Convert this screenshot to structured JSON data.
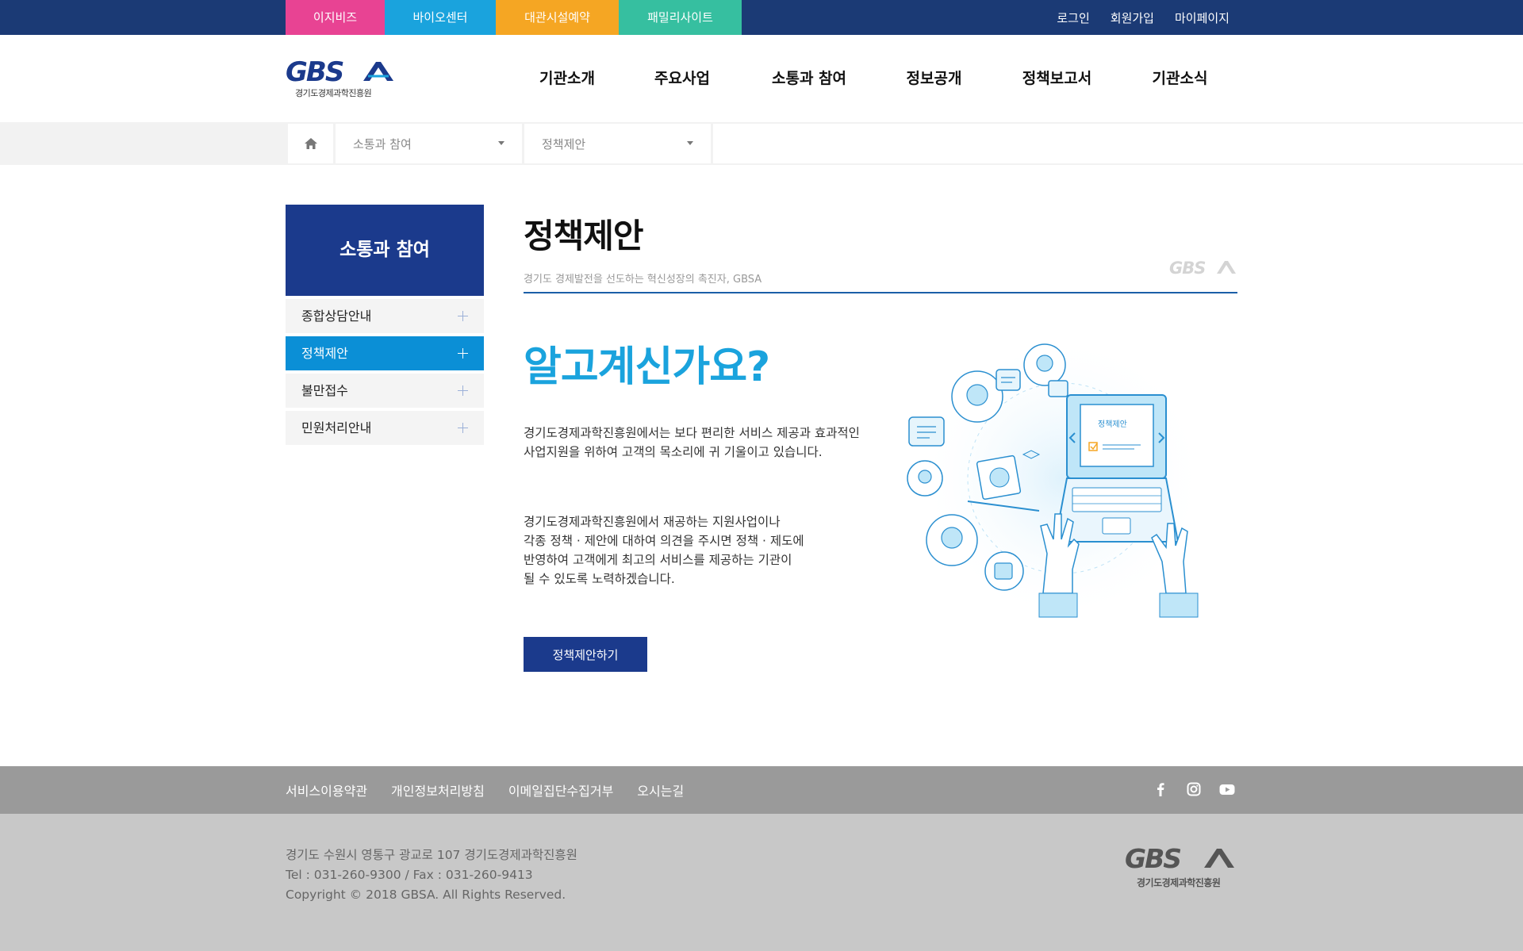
{
  "topbar": {
    "sites": [
      {
        "label": "이지비즈",
        "color": "#e84393"
      },
      {
        "label": "바이오센터",
        "color": "#1aa3dd"
      },
      {
        "label": "대관시설예약",
        "color": "#f5a623"
      },
      {
        "label": "패밀리사이트",
        "color": "#36bfa0"
      }
    ],
    "util": [
      "로그인",
      "회원가입",
      "마이페이지"
    ]
  },
  "header": {
    "logo_sub": "경기도경제과학진흥원",
    "gnb": [
      "기관소개",
      "주요사업",
      "소통과 참여",
      "정보공개",
      "정책보고서",
      "기관소식"
    ]
  },
  "breadcrumb": {
    "level1": "소통과 참여",
    "level2": "정책제안"
  },
  "lnb": {
    "title": "소통과 참여",
    "items": [
      {
        "label": "종합상담안내",
        "active": false
      },
      {
        "label": "정책제안",
        "active": true
      },
      {
        "label": "불만접수",
        "active": false
      },
      {
        "label": "민원처리안내",
        "active": false
      }
    ]
  },
  "content": {
    "title": "정책제안",
    "subtitle": "경기도 경제발전을 선도하는 혁신성장의 촉진자, GBSA",
    "heading": "알고계신가요?",
    "para1": "경기도경제과학진흥원에서는 보다 편리한 서비스 제공과 효과적인 사업지원을 위하여 고객의 목소리에 귀 기울이고 있습니다.",
    "para2_lines": [
      "경기도경제과학진흥원에서 재공하는 지원사업이나",
      "각종 정책 · 제안에 대하여 의견을 주시면 정책 · 제도에",
      "반영하여 고객에게 최고의 서비스를 제공하는 기관이",
      "될 수 있도록 노력하겠습니다."
    ],
    "cta": "정책제안하기",
    "illust_label": "정책제안"
  },
  "footer": {
    "links": [
      "서비스이용약관",
      "개인정보처리방침",
      "이메일집단수집거부",
      "오시는길"
    ],
    "address": "경기도 수원시 영통구 광교로 107 경기도경제과학진흥원",
    "tel": "Tel : 031-260-9300 / Fax : 031-260-9413",
    "copyright": "Copyright © 2018 GBSA. All Rights Reserved.",
    "logo_sub": "경기도경제과학진흥원"
  },
  "colors": {
    "navy": "#1b3a8c",
    "topbar": "#1b3a75",
    "accent_blue": "#1aa3dd",
    "active_menu": "#0b8fd6"
  },
  "icons": [
    "home-icon",
    "facebook-icon",
    "instagram-icon",
    "youtube-icon"
  ]
}
